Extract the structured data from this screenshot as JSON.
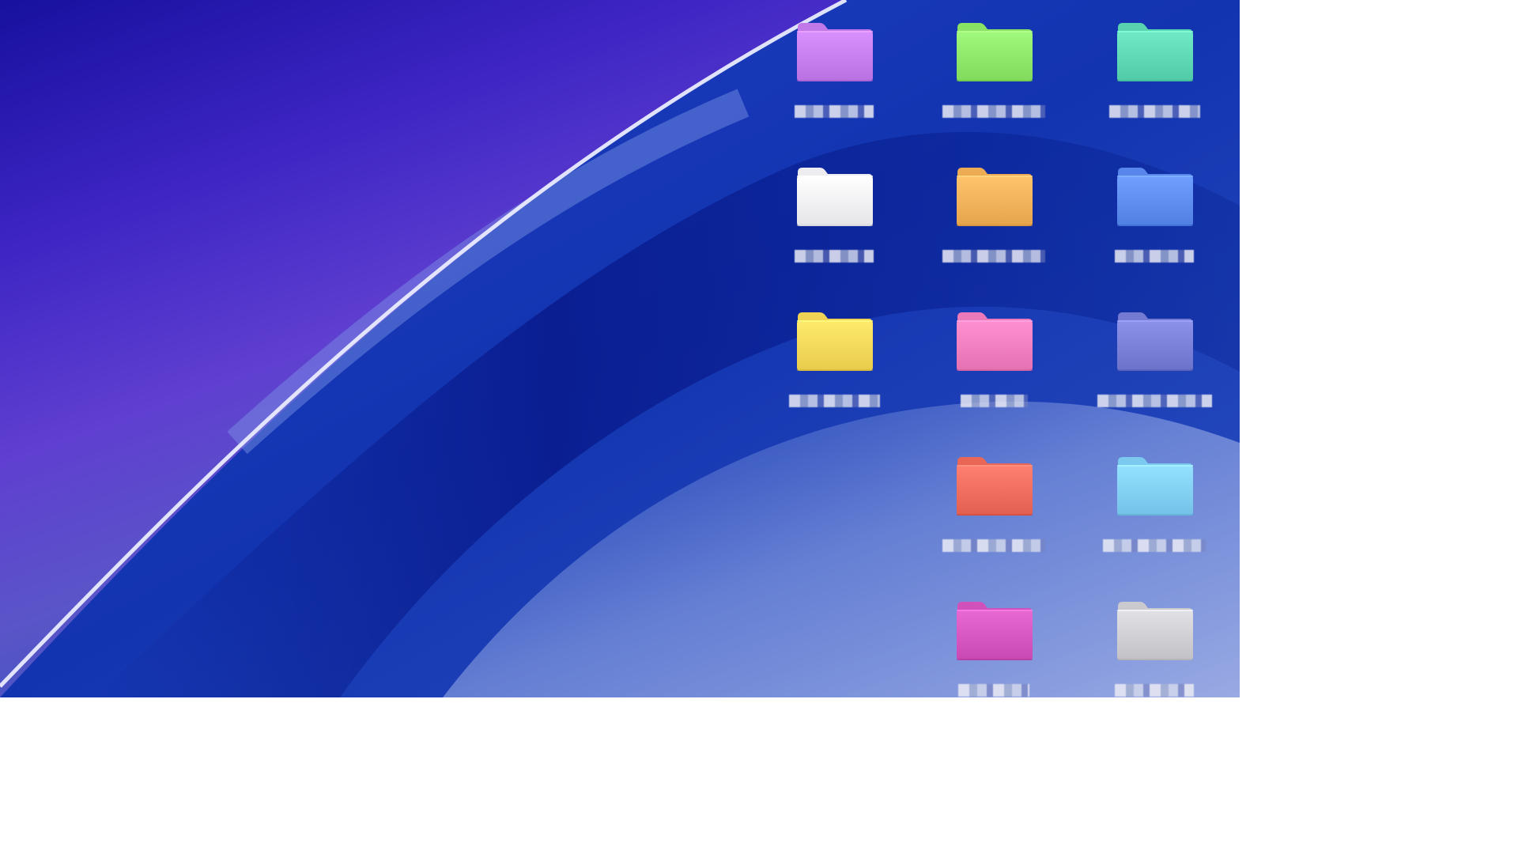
{
  "desktop": {
    "folders": [
      {
        "label": "",
        "color": "#c77ff0",
        "col": 0,
        "row": 0
      },
      {
        "label": "",
        "color": "#8fe86a",
        "col": 1,
        "row": 0
      },
      {
        "label": "",
        "color": "#5fd9b5",
        "col": 2,
        "row": 0
      },
      {
        "label": "",
        "color": "#f3f3f7",
        "col": 0,
        "row": 1
      },
      {
        "label": "",
        "color": "#f3b25a",
        "col": 1,
        "row": 1
      },
      {
        "label": "",
        "color": "#5d8df0",
        "col": 2,
        "row": 1
      },
      {
        "label": "",
        "color": "#f6d95a",
        "col": 0,
        "row": 2
      },
      {
        "label": "",
        "color": "#f27fbf",
        "col": 1,
        "row": 2
      },
      {
        "label": "",
        "color": "#7a7fd8",
        "col": 2,
        "row": 2
      },
      {
        "label": "",
        "color": "#f06d5e",
        "col": 1,
        "row": 3
      },
      {
        "label": "",
        "color": "#82cff5",
        "col": 2,
        "row": 3
      },
      {
        "label": "",
        "color": "#d657c0",
        "col": 1,
        "row": 4
      },
      {
        "label": "",
        "color": "#cfcfd4",
        "col": 2,
        "row": 4
      }
    ]
  }
}
